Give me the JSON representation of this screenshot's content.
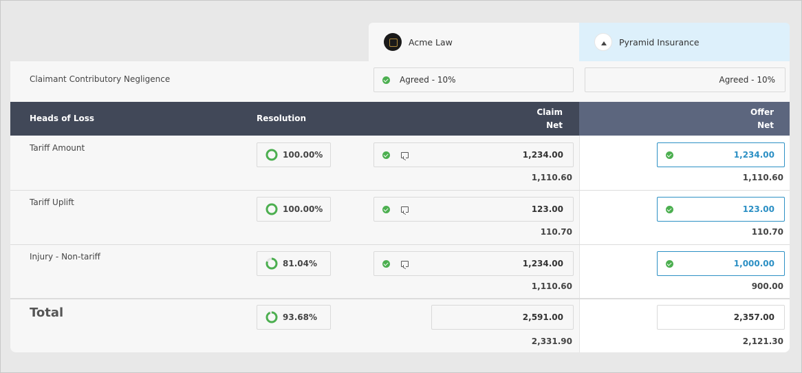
{
  "parties": [
    {
      "name": "Acme Law",
      "logo_icon": "scales-logo-icon"
    },
    {
      "name": "Pyramid Insurance",
      "logo_icon": "pyramid-logo-icon"
    }
  ],
  "negligence": {
    "label": "Claimant Contributory Negligence",
    "claim_value": "Agreed - 10%",
    "offer_value": "Agreed - 10%"
  },
  "header": {
    "heads_of_loss": "Heads of Loss",
    "resolution": "Resolution",
    "claim": "Claim",
    "claim_net": "Net",
    "offer": "Offer",
    "offer_net": "Net"
  },
  "rows": [
    {
      "label": "Tariff Amount",
      "resolution": "100.00%",
      "resolution_fraction": 1.0,
      "claim": "1,234.00",
      "claim_net": "1,110.60",
      "offer": "1,234.00",
      "offer_net": "1,110.60"
    },
    {
      "label": "Tariff Uplift",
      "resolution": "100.00%",
      "resolution_fraction": 1.0,
      "claim": "123.00",
      "claim_net": "110.70",
      "offer": "123.00",
      "offer_net": "110.70"
    },
    {
      "label": "Injury - Non-tariff",
      "resolution": "81.04%",
      "resolution_fraction": 0.8104,
      "claim": "1,234.00",
      "claim_net": "1,110.60",
      "offer": "1,000.00",
      "offer_net": "900.00"
    }
  ],
  "total": {
    "label": "Total",
    "resolution": "93.68%",
    "resolution_fraction": 0.9368,
    "claim": "2,591.00",
    "claim_net": "2,331.90",
    "offer": "2,357.00",
    "offer_net": "2,121.30"
  },
  "colors": {
    "accent": "#2b8fc4",
    "header_bg": "#414858",
    "offer_header_bg": "#5c667e",
    "agreed_green": "#4caf50",
    "pyramid_tab_bg": "#ddf0fb"
  }
}
